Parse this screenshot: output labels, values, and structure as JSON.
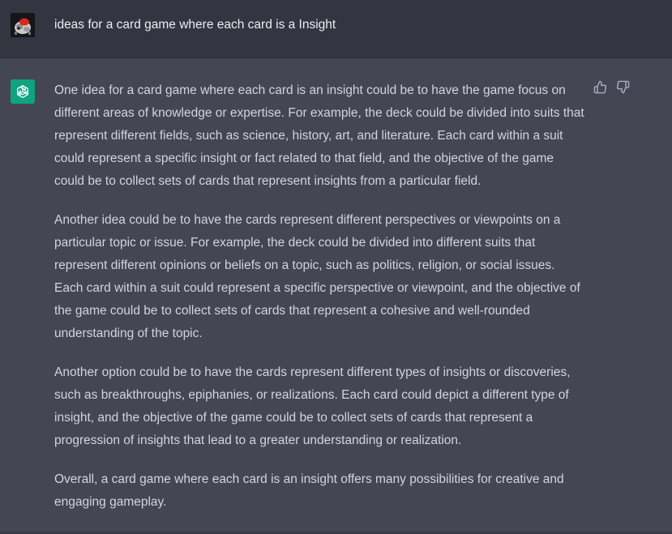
{
  "user_message": {
    "text": "ideas for a card game where each card is a Insight"
  },
  "assistant_message": {
    "paragraphs": [
      "One idea for a card game where each card is an insight could be to have the game focus on different areas of knowledge or expertise. For example, the deck could be divided into suits that represent different fields, such as science, history, art, and literature. Each card within a suit could represent a specific insight or fact related to that field, and the objective of the game could be to collect sets of cards that represent insights from a particular field.",
      "Another idea could be to have the cards represent different perspectives or viewpoints on a particular topic or issue. For example, the deck could be divided into different suits that represent different opinions or beliefs on a topic, such as politics, religion, or social issues. Each card within a suit could represent a specific perspective or viewpoint, and the objective of the game could be to collect sets of cards that represent a cohesive and well-rounded understanding of the topic.",
      "Another option could be to have the cards represent different types of insights or discoveries, such as breakthroughs, epiphanies, or realizations. Each card could depict a different type of insight, and the objective of the game could be to collect sets of cards that represent a progression of insights that lead to a greater understanding or realization.",
      "Overall, a card game where each card is an insight offers many possibilities for creative and engaging gameplay."
    ]
  },
  "icons": {
    "user_avatar": "user-avatar-image",
    "bot_avatar": "openai-logo-icon",
    "thumbs_up": "thumbs-up-icon",
    "thumbs_down": "thumbs-down-icon"
  },
  "colors": {
    "user_bg": "#343541",
    "assistant_bg": "#444654",
    "bot_avatar_bg": "#10a37f",
    "text": "#d1d5db"
  }
}
